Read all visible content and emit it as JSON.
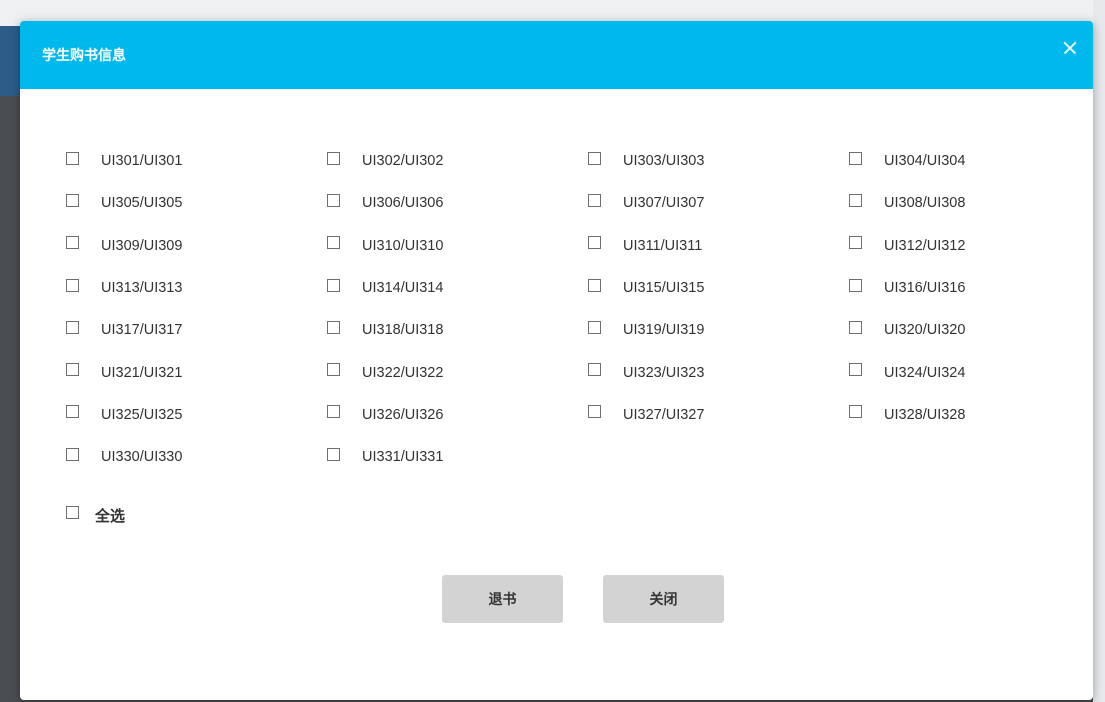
{
  "modal": {
    "title": "学生购书信息",
    "close_icon": "close-icon"
  },
  "options": [
    {
      "label": "UI301/UI301",
      "checked": false
    },
    {
      "label": "UI302/UI302",
      "checked": false
    },
    {
      "label": "UI303/UI303",
      "checked": false
    },
    {
      "label": "UI304/UI304",
      "checked": false
    },
    {
      "label": "UI305/UI305",
      "checked": false
    },
    {
      "label": "UI306/UI306",
      "checked": false
    },
    {
      "label": "UI307/UI307",
      "checked": false
    },
    {
      "label": "UI308/UI308",
      "checked": false
    },
    {
      "label": "UI309/UI309",
      "checked": false
    },
    {
      "label": "UI310/UI310",
      "checked": false
    },
    {
      "label": "UI311/UI311",
      "checked": false
    },
    {
      "label": "UI312/UI312",
      "checked": false
    },
    {
      "label": "UI313/UI313",
      "checked": false
    },
    {
      "label": "UI314/UI314",
      "checked": false
    },
    {
      "label": "UI315/UI315",
      "checked": false
    },
    {
      "label": "UI316/UI316",
      "checked": false
    },
    {
      "label": "UI317/UI317",
      "checked": false
    },
    {
      "label": "UI318/UI318",
      "checked": false
    },
    {
      "label": "UI319/UI319",
      "checked": false
    },
    {
      "label": "UI320/UI320",
      "checked": false
    },
    {
      "label": "UI321/UI321",
      "checked": false
    },
    {
      "label": "UI322/UI322",
      "checked": false
    },
    {
      "label": "UI323/UI323",
      "checked": false
    },
    {
      "label": "UI324/UI324",
      "checked": false
    },
    {
      "label": "UI325/UI325",
      "checked": false
    },
    {
      "label": "UI326/UI326",
      "checked": false
    },
    {
      "label": "UI327/UI327",
      "checked": false
    },
    {
      "label": "UI328/UI328",
      "checked": false
    },
    {
      "label": "UI330/UI330",
      "checked": false
    },
    {
      "label": "UI331/UI331",
      "checked": false
    }
  ],
  "select_all": {
    "label": "全选",
    "checked": false
  },
  "buttons": {
    "return_label": "退书",
    "close_label": "关闭"
  },
  "colors": {
    "header": "#00b9ec",
    "button_bg": "#d3d3d3"
  }
}
